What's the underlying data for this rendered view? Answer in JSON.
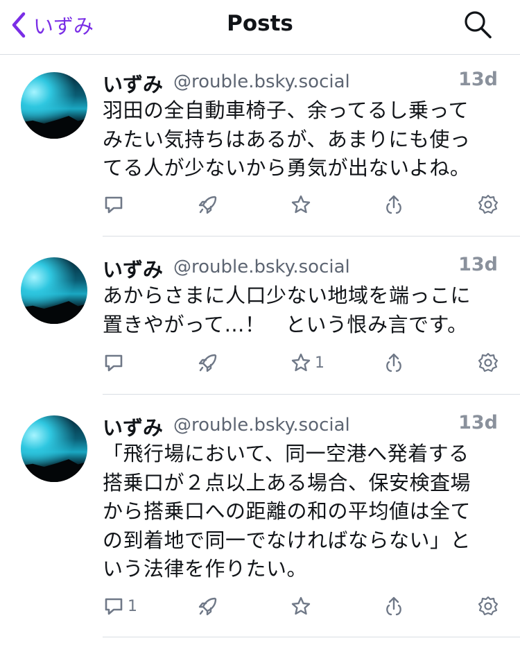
{
  "header": {
    "back_label": "いずみ",
    "title": "Posts"
  },
  "posts": [
    {
      "author": "いずみ",
      "handle": "@rouble.bsky.social",
      "time": "13d",
      "lines": [
        "羽田の全自動車椅子、余ってるし乗って",
        "みたい気持ちはあるが、あまりにも使っ",
        "てる人が少ないから勇気が出ないよね。"
      ],
      "reply_count": "",
      "like_count": ""
    },
    {
      "author": "いずみ",
      "handle": "@rouble.bsky.social",
      "time": "13d",
      "lines": [
        "あからさまに人口少ない地域を端っこに",
        "置きやがって…！　という恨み言です。"
      ],
      "reply_count": "",
      "like_count": "1"
    },
    {
      "author": "いずみ",
      "handle": "@rouble.bsky.social",
      "time": "13d",
      "lines": [
        "「飛行場において、同一空港へ発着する",
        "搭乗口が２点以上ある場合、保安検査場",
        "から搭乗口への距離の和の平均値は全て",
        "の到着地で同一でなければならない」と",
        "いう法律を作りたい。"
      ],
      "reply_count": "1",
      "like_count": ""
    }
  ]
}
